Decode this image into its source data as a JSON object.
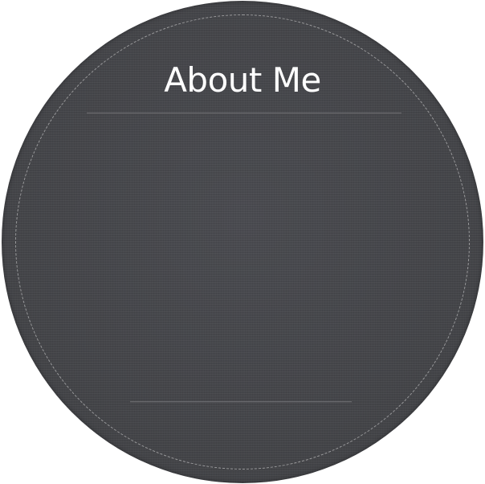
{
  "card": {
    "title": "About Me",
    "background_color": "#46474b",
    "text_color": "#ffffff",
    "stitch_color": "#e1e1e1"
  }
}
